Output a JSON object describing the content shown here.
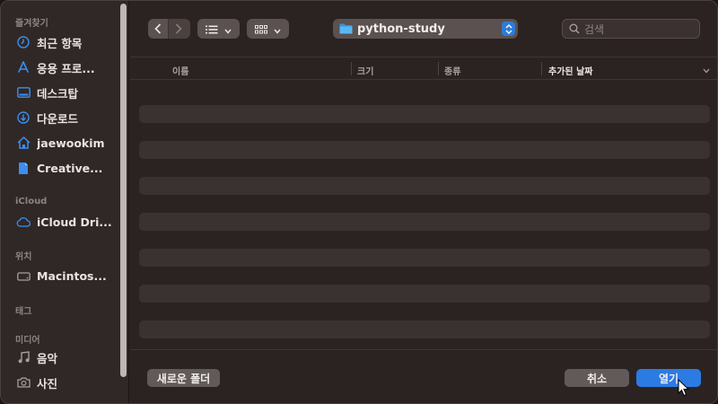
{
  "sidebar": {
    "favorites_heading": "즐겨찾기",
    "favorites": [
      {
        "label": "최근 항목",
        "icon": "clock-icon"
      },
      {
        "label": "응용 프로...",
        "icon": "applications-icon"
      },
      {
        "label": "데스크탑",
        "icon": "desktop-icon"
      },
      {
        "label": "다운로드",
        "icon": "download-icon"
      },
      {
        "label": "jaewookim",
        "icon": "home-icon"
      },
      {
        "label": "Creative...",
        "icon": "document-icon"
      }
    ],
    "icloud_heading": "iCloud",
    "icloud": [
      {
        "label": "iCloud Dri...",
        "icon": "cloud-icon"
      }
    ],
    "locations_heading": "위치",
    "locations": [
      {
        "label": "Macintos...",
        "icon": "disk-icon"
      }
    ],
    "tags_heading": "태그",
    "media_heading": "미디어",
    "media": [
      {
        "label": "음악",
        "icon": "music-icon"
      },
      {
        "label": "사진",
        "icon": "camera-icon"
      }
    ]
  },
  "toolbar": {
    "current_folder": "python-study",
    "search_placeholder": "검색"
  },
  "columns": {
    "name": "이름",
    "size": "크기",
    "kind": "종류",
    "date_added": "추가된 날짜"
  },
  "footer": {
    "new_folder_label": "새로운 폴더",
    "cancel_label": "취소",
    "open_label": "열기"
  },
  "colors": {
    "accent": "#2c7be3",
    "window_bg": "#2b2322",
    "sidebar_bg": "#302826"
  }
}
